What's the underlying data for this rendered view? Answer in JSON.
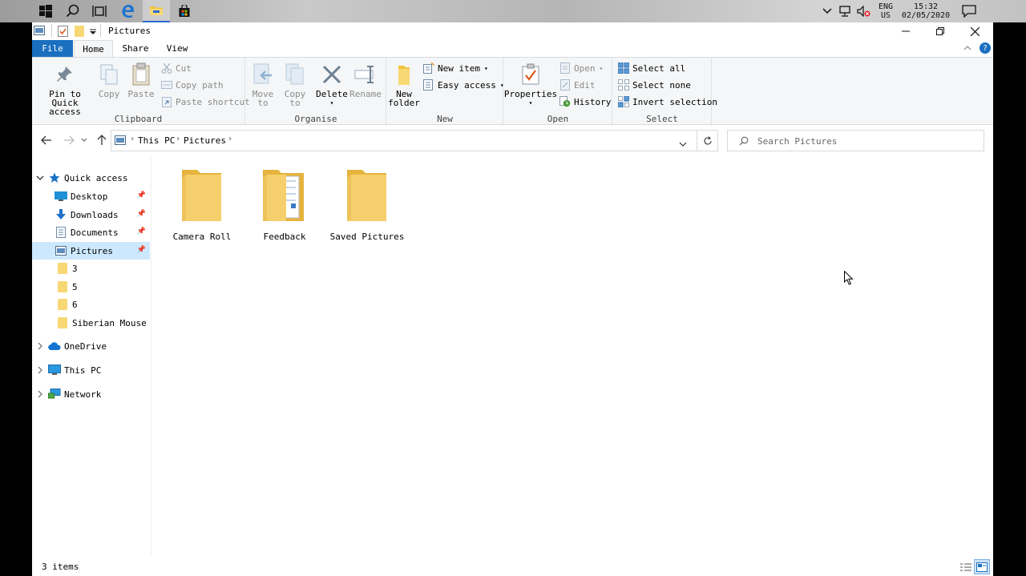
{
  "taskbar": {
    "buttons": [
      "start-icon",
      "search-icon",
      "task-view-icon",
      "edge-icon",
      "file-explorer-icon",
      "store-icon"
    ],
    "tray": {
      "language_line1": "ENG",
      "language_line2": "US",
      "time": "15:32",
      "date": "02/05/2020"
    }
  },
  "window": {
    "title": "Pictures",
    "tabs": {
      "file": "File",
      "home": "Home",
      "share": "Share",
      "view": "View"
    },
    "ribbon": {
      "clipboard": {
        "label": "Clipboard",
        "pin_line1": "Pin to Quick",
        "pin_line2": "access",
        "copy": "Copy",
        "paste": "Paste",
        "cut": "Cut",
        "copy_path": "Copy path",
        "paste_shortcut": "Paste shortcut"
      },
      "organise": {
        "label": "Organise",
        "move_line1": "Move",
        "move_line2": "to",
        "copy_line1": "Copy",
        "copy_line2": "to",
        "delete": "Delete",
        "rename": "Rename"
      },
      "new": {
        "label": "New",
        "folder_line1": "New",
        "folder_line2": "folder",
        "new_item": "New item",
        "easy_access": "Easy access"
      },
      "open": {
        "label": "Open",
        "properties": "Properties",
        "open": "Open",
        "edit": "Edit",
        "history": "History"
      },
      "select": {
        "label": "Select",
        "select_all": "Select all",
        "select_none": "Select none",
        "invert": "Invert selection"
      }
    },
    "address": {
      "this_pc": "This PC",
      "pictures": "Pictures",
      "search_placeholder": "Search Pictures"
    },
    "navpane": {
      "quick_access": "Quick access",
      "desktop": "Desktop",
      "downloads": "Downloads",
      "documents": "Documents",
      "pictures": "Pictures",
      "f3": "3",
      "f5": "5",
      "f6": "6",
      "siberian": "Siberian Mouse",
      "onedrive": "OneDrive",
      "this_pc": "This PC",
      "network": "Network"
    },
    "folders": [
      {
        "name": "Camera Roll"
      },
      {
        "name": "Feedback"
      },
      {
        "name": "Saved Pictures"
      }
    ],
    "status": "3 items"
  },
  "colors": {
    "accent": "#1a6fbf",
    "selection": "#cce8ff",
    "folder": "#f8d775"
  }
}
